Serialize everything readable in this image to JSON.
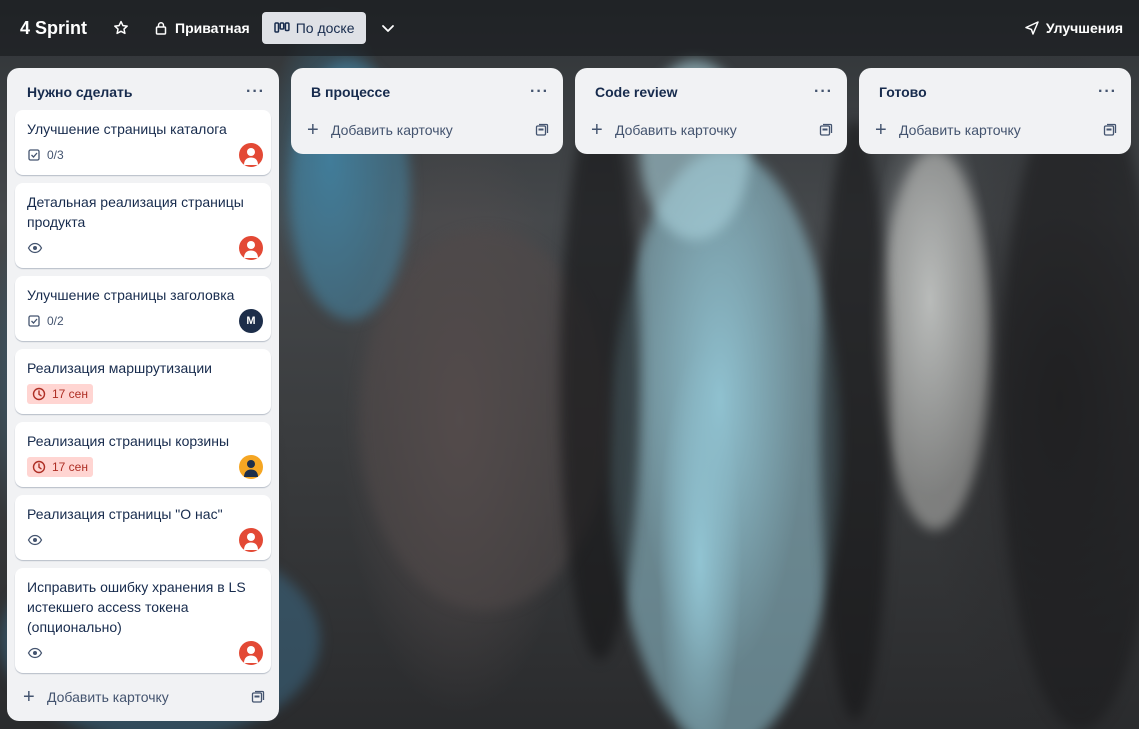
{
  "board": {
    "title": "4 Sprint",
    "visibility_label": "Приватная",
    "view_label": "По доске",
    "improvements_label": "Улучшения"
  },
  "lists": [
    {
      "title": "Нужно сделать",
      "add_card_label": "Добавить карточку",
      "cards": [
        {
          "title": "Улучшение страницы каталога",
          "badge_type": "checklist",
          "badge_text": "0/3",
          "avatar": "user-red"
        },
        {
          "title": "Детальная реализация страницы продукта",
          "badge_type": "watch",
          "badge_text": "",
          "avatar": "user-red"
        },
        {
          "title": "Улучшение страницы заголовка",
          "badge_type": "checklist",
          "badge_text": "0/2",
          "avatar": "M"
        },
        {
          "title": "Реализация маршрутизации",
          "badge_type": "due",
          "badge_text": "17 сен",
          "avatar": ""
        },
        {
          "title": "Реализация страницы корзины",
          "badge_type": "due",
          "badge_text": "17 сен",
          "avatar": "user-orange"
        },
        {
          "title": "Реализация страницы \"О нас\"",
          "badge_type": "watch",
          "badge_text": "",
          "avatar": "user-red"
        },
        {
          "title": "Исправить ошибку хранения в LS истекшего access токена (опционально)",
          "badge_type": "watch",
          "badge_text": "",
          "avatar": "user-red"
        }
      ]
    },
    {
      "title": "В процессе",
      "add_card_label": "Добавить карточку",
      "cards": []
    },
    {
      "title": "Code review",
      "add_card_label": "Добавить карточку",
      "cards": []
    },
    {
      "title": "Готово",
      "add_card_label": "Добавить карточку",
      "cards": []
    }
  ],
  "colors": {
    "due_bg": "#ffd5d2",
    "due_text": "#ae2e24",
    "avatar_red": "#e34935",
    "avatar_navy": "#1d2e4a",
    "avatar_orange": "#f5a623"
  },
  "icons": {
    "star": "star-icon",
    "lock": "lock-icon",
    "board_view": "board-view-icon",
    "chevron": "chevron-down-icon",
    "improvements": "rocket-icon",
    "more": "more-dots-icon",
    "add": "plus-icon",
    "template": "card-template-icon",
    "checklist": "checklist-icon",
    "watch": "eye-icon",
    "due": "clock-icon"
  }
}
